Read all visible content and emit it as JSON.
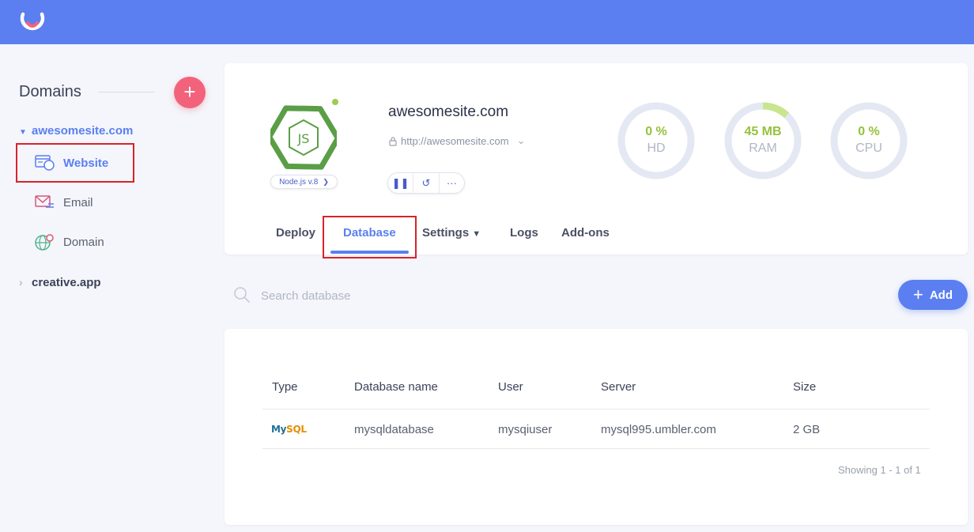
{
  "sidebar": {
    "title": "Domains",
    "domains": [
      {
        "name": "awesomesite.com",
        "expanded": true,
        "items": [
          {
            "label": "Website",
            "icon": "website-icon",
            "active": true
          },
          {
            "label": "Email",
            "icon": "email-icon"
          },
          {
            "label": "Domain",
            "icon": "globe-icon"
          }
        ]
      },
      {
        "name": "creative.app",
        "expanded": false
      }
    ]
  },
  "site": {
    "title": "awesomesite.com",
    "url": "http://awesomesite.com",
    "runtime": "Node.js v.8",
    "status_color": "#9ccc54"
  },
  "metrics": [
    {
      "value": "0 %",
      "label": "HD",
      "fill": 0
    },
    {
      "value": "45 MB",
      "label": "RAM",
      "fill": 0.12
    },
    {
      "value": "0 %",
      "label": "CPU",
      "fill": 0
    }
  ],
  "tabs": [
    {
      "label": "Deploy"
    },
    {
      "label": "Database",
      "active": true
    },
    {
      "label": "Settings"
    },
    {
      "label": "Logs"
    },
    {
      "label": "Add-ons"
    }
  ],
  "search": {
    "placeholder": "Search database"
  },
  "add_button": {
    "label": "Add"
  },
  "table": {
    "columns": [
      "Type",
      "Database name",
      "User",
      "Server",
      "Size"
    ],
    "rows": [
      {
        "type_logo_my": "My",
        "type_logo_sql": "SQL",
        "name": "mysqldatabase",
        "user": "mysqiuser",
        "server": "mysql995.umbler.com",
        "size": "2 GB"
      }
    ],
    "pagination": "Showing 1 - 1 of 1"
  },
  "colors": {
    "primary": "#5b7ff0",
    "accent": "#f2637b",
    "success": "#94c23d"
  }
}
